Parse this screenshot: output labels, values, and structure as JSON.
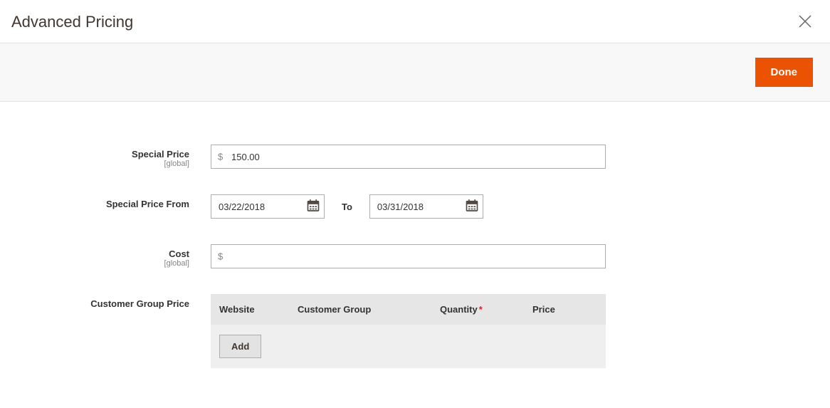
{
  "modal": {
    "title": "Advanced Pricing",
    "done_label": "Done"
  },
  "form": {
    "special_price": {
      "label": "Special Price",
      "scope": "[global]",
      "currency": "$",
      "value": "150.00"
    },
    "special_price_from": {
      "label": "Special Price From",
      "from_value": "03/22/2018",
      "to_label": "To",
      "to_value": "03/31/2018"
    },
    "cost": {
      "label": "Cost",
      "scope": "[global]",
      "currency": "$",
      "value": ""
    },
    "customer_group_price": {
      "label": "Customer Group Price",
      "columns": {
        "website": "Website",
        "group": "Customer Group",
        "quantity": "Quantity",
        "price": "Price"
      },
      "add_label": "Add"
    }
  }
}
